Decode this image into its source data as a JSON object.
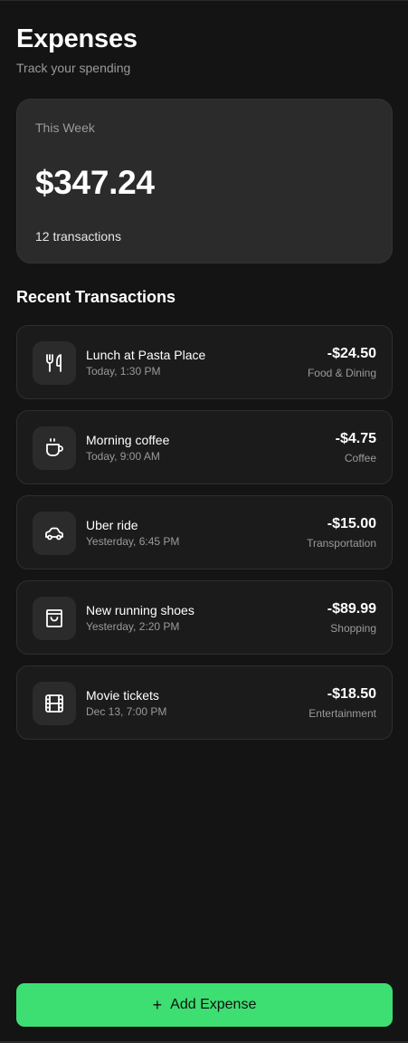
{
  "header": {
    "title": "Expenses",
    "subtitle": "Track your spending"
  },
  "summary": {
    "period": "This Week",
    "amount": "$347.24",
    "count": "12 transactions"
  },
  "section": {
    "title": "Recent Transactions"
  },
  "transactions": [
    {
      "icon": "utensils-icon",
      "name": "Lunch at Pasta Place",
      "time": "Today, 1:30 PM",
      "amount": "-$24.50",
      "category": "Food & Dining"
    },
    {
      "icon": "coffee-cup-icon",
      "name": "Morning coffee",
      "time": "Today, 9:00 AM",
      "amount": "-$4.75",
      "category": "Coffee"
    },
    {
      "icon": "car-icon",
      "name": "Uber ride",
      "time": "Yesterday, 6:45 PM",
      "amount": "-$15.00",
      "category": "Transportation"
    },
    {
      "icon": "shopping-bag-icon",
      "name": "New running shoes",
      "time": "Yesterday, 2:20 PM",
      "amount": "-$89.99",
      "category": "Shopping"
    },
    {
      "icon": "film-icon",
      "name": "Movie tickets",
      "time": "Dec 13, 7:00 PM",
      "amount": "-$18.50",
      "category": "Entertainment"
    }
  ],
  "actions": {
    "add_icon": "plus-icon",
    "add_label": "Add Expense"
  },
  "colors": {
    "background": "#141414",
    "card": "#2b2b2b",
    "accent": "#3ddf72",
    "muted_text": "#9a9a9a"
  }
}
